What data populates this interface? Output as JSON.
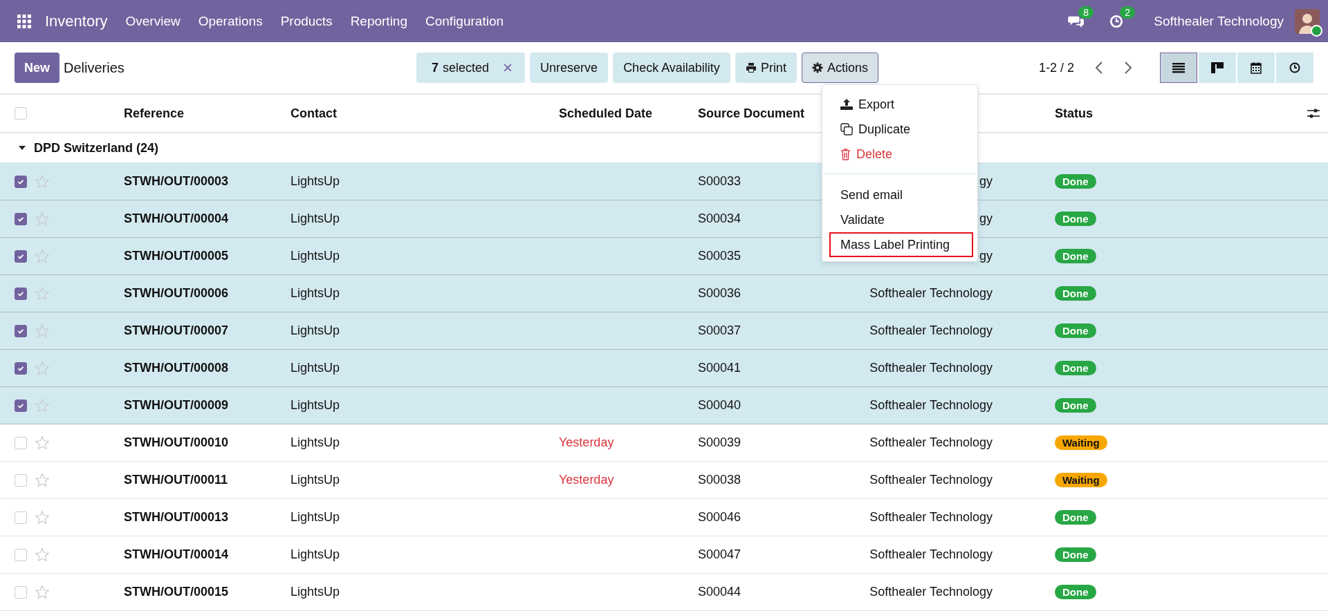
{
  "navbar": {
    "app": "Inventory",
    "menu": [
      "Overview",
      "Operations",
      "Products",
      "Reporting",
      "Configuration"
    ],
    "messages_count": "8",
    "activities_count": "2",
    "company": "Softhealer Technology",
    "online": true
  },
  "control_panel": {
    "new_button": "New",
    "title": "Deliveries",
    "selection": {
      "count": "7",
      "label": "selected",
      "clear": "×"
    },
    "buttons": [
      {
        "label": "Unreserve",
        "kind": "text"
      },
      {
        "label": "Check Availability",
        "kind": "text"
      },
      {
        "label": "Print",
        "kind": "print"
      },
      {
        "label": "Actions",
        "kind": "actions",
        "expanded": true
      }
    ],
    "pager": "1-2 / 2",
    "views": [
      {
        "kind": "list",
        "selected": true
      },
      {
        "kind": "kanban",
        "selected": false
      },
      {
        "kind": "calendar",
        "selected": false
      },
      {
        "kind": "activity",
        "selected": false
      }
    ]
  },
  "actions_menu": [
    {
      "label": "Export",
      "kind": "export",
      "danger": false,
      "highlighted": false,
      "separator_before": false
    },
    {
      "label": "Duplicate",
      "kind": "duplicate",
      "danger": false,
      "highlighted": false,
      "separator_before": false
    },
    {
      "label": "Delete",
      "kind": "delete",
      "danger": true,
      "highlighted": false,
      "separator_before": false
    },
    {
      "label": "Send email",
      "kind": "plain",
      "danger": false,
      "highlighted": false,
      "separator_before": true
    },
    {
      "label": "Validate",
      "kind": "plain",
      "danger": false,
      "highlighted": false,
      "separator_before": false
    },
    {
      "label": "Mass Label Printing",
      "kind": "plain",
      "danger": false,
      "highlighted": true,
      "separator_before": false
    }
  ],
  "table": {
    "all_selected": false,
    "columns": [
      "Reference",
      "Contact",
      "Scheduled Date",
      "Source Document",
      "Status"
    ],
    "group": {
      "label": "DPD Switzerland (24)",
      "expanded": true
    },
    "rows": [
      {
        "selected": true,
        "starred": false,
        "reference": "STWH/OUT/00003",
        "contact": "LightsUp",
        "source": "S00033",
        "column_6": "gy",
        "status": "Done",
        "color": "#28a745"
      },
      {
        "selected": true,
        "starred": false,
        "reference": "STWH/OUT/00004",
        "contact": "LightsUp",
        "source": "S00034",
        "column_6": "gy",
        "status": "Done",
        "color": "#28a745"
      },
      {
        "selected": true,
        "starred": false,
        "reference": "STWH/OUT/00005",
        "contact": "LightsUp",
        "source": "S00035",
        "column_6": "gy",
        "status": "Done",
        "color": "#28a745"
      },
      {
        "selected": true,
        "starred": false,
        "reference": "STWH/OUT/00006",
        "contact": "LightsUp",
        "source": "S00036",
        "column_6": "Softhealer Technology",
        "status": "Done",
        "color": "#28a745"
      },
      {
        "selected": true,
        "starred": false,
        "reference": "STWH/OUT/00007",
        "contact": "LightsUp",
        "source": "S00037",
        "column_6": "Softhealer Technology",
        "status": "Done",
        "color": "#28a745"
      },
      {
        "selected": true,
        "starred": false,
        "reference": "STWH/OUT/00008",
        "contact": "LightsUp",
        "source": "S00041",
        "column_6": "Softhealer Technology",
        "status": "Done",
        "color": "#28a745"
      },
      {
        "selected": true,
        "starred": false,
        "reference": "STWH/OUT/00009",
        "contact": "LightsUp",
        "source": "S00040",
        "column_6": "Softhealer Technology",
        "status": "Done",
        "color": "#28a745"
      },
      {
        "selected": false,
        "starred": false,
        "reference": "STWH/OUT/00010",
        "contact": "LightsUp",
        "scheduled": "Yesterday",
        "overdue": true,
        "source": "S00039",
        "column_6": "Softhealer Technology",
        "status": "Waiting",
        "color": "#f7a700"
      },
      {
        "selected": false,
        "starred": false,
        "reference": "STWH/OUT/00011",
        "contact": "LightsUp",
        "scheduled": "Yesterday",
        "overdue": true,
        "source": "S00038",
        "column_6": "Softhealer Technology",
        "status": "Waiting",
        "color": "#f7a700"
      },
      {
        "selected": false,
        "starred": false,
        "reference": "STWH/OUT/00013",
        "contact": "LightsUp",
        "source": "S00046",
        "column_6": "Softhealer Technology",
        "status": "Done",
        "color": "#28a745"
      },
      {
        "selected": false,
        "starred": false,
        "reference": "STWH/OUT/00014",
        "contact": "LightsUp",
        "source": "S00047",
        "column_6": "Softhealer Technology",
        "status": "Done",
        "color": "#28a745"
      },
      {
        "selected": false,
        "starred": false,
        "reference": "STWH/OUT/00015",
        "contact": "LightsUp",
        "source": "S00044",
        "column_6": "Softhealer Technology",
        "status": "Done",
        "color": "#28a745"
      }
    ]
  }
}
